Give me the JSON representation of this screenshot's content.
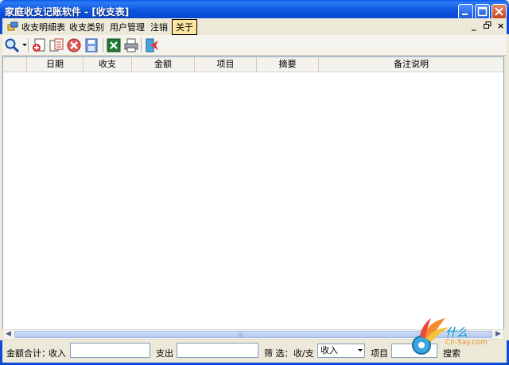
{
  "window": {
    "title": "家庭收支记账软件 - [收支表]",
    "controls": [
      "minimize",
      "maximize",
      "close"
    ]
  },
  "menu": {
    "items": [
      {
        "label": "收支明细表"
      },
      {
        "label": "收支类别"
      },
      {
        "label": "用户管理"
      },
      {
        "label": "注销"
      },
      {
        "label": "关于",
        "active": true
      }
    ],
    "mdi_controls": {
      "minimize": "_",
      "restore": "🗗",
      "close": "×"
    }
  },
  "toolbar": {
    "buttons": [
      {
        "icon": "search-icon"
      },
      {
        "icon": "add-record-icon"
      },
      {
        "icon": "copy-record-icon"
      },
      {
        "icon": "delete-icon"
      },
      {
        "icon": "save-icon"
      },
      {
        "icon": "excel-export-icon"
      },
      {
        "icon": "print-icon"
      },
      {
        "icon": "exit-icon"
      }
    ]
  },
  "grid": {
    "columns": [
      "日期",
      "收支",
      "金额",
      "项目",
      "摘要",
      "备注说明"
    ],
    "rows": []
  },
  "statusbar": {
    "total_label": "金额合计：",
    "income_label": "收入",
    "income_value": "",
    "expense_label": "支出",
    "expense_value": "",
    "filter_label": "筛 选：",
    "type_label": "收/支",
    "type_value": "收入",
    "item_label": "项目",
    "search_label": "搜索"
  },
  "watermark": {
    "text": "什么",
    "sub": "Cn-Say.com"
  },
  "colors": {
    "titlebar": "#0a5ae8",
    "frame": "#0b4bd6",
    "face": "#ece9d8",
    "active_menu": "#fde6a2"
  }
}
